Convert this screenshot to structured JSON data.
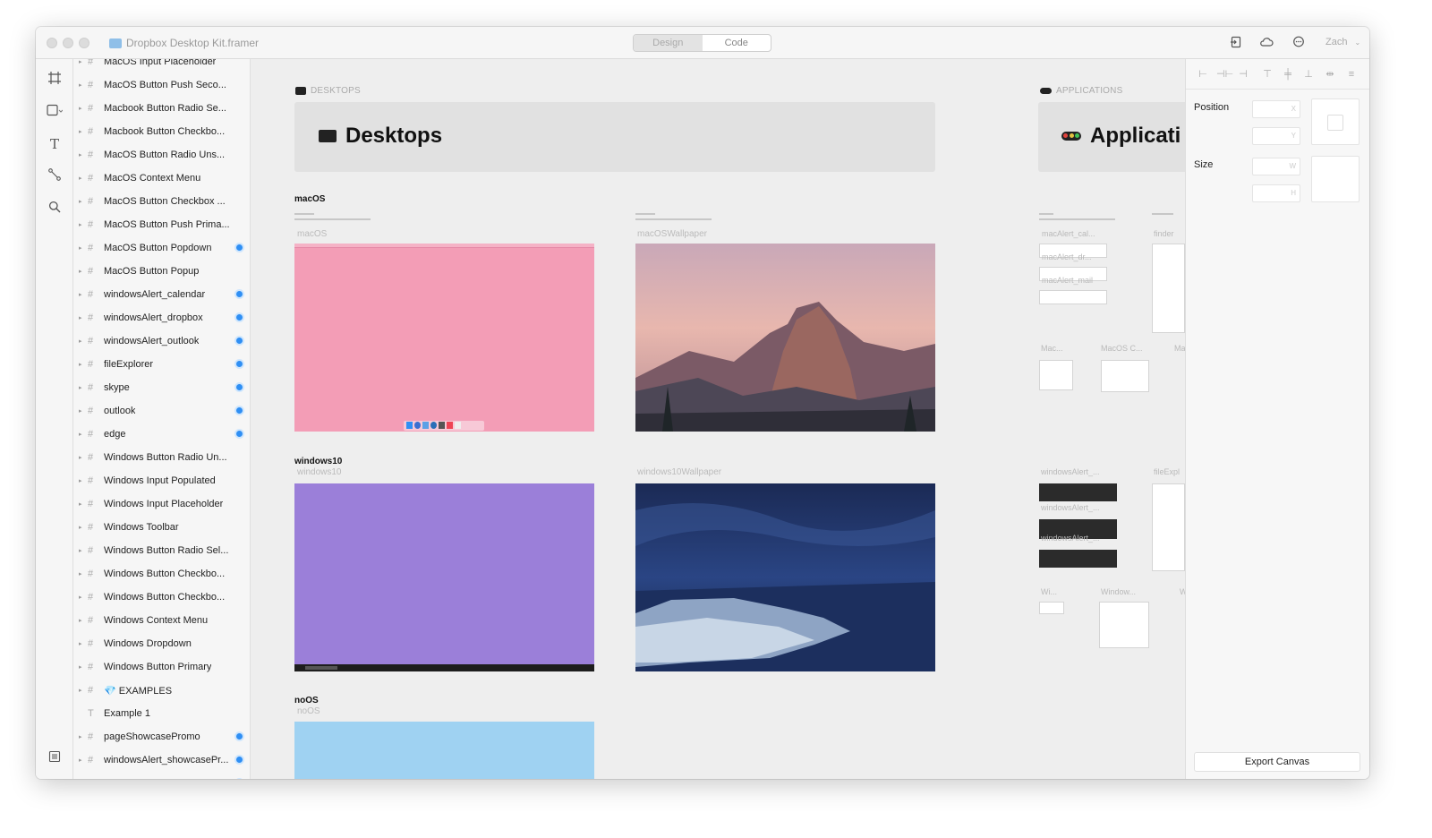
{
  "window": {
    "title": "Dropbox Desktop Kit.framer",
    "mode_tabs": [
      "Design",
      "Code"
    ],
    "active_mode": "Design",
    "user": "Zach",
    "toolbar_icons": [
      "preview-icon",
      "cloud-icon",
      "comment-icon"
    ]
  },
  "tools": [
    "frame-tool-icon",
    "shape-tool-icon",
    "text-tool-icon",
    "path-tool-icon",
    "search-tool-icon"
  ],
  "layers": [
    {
      "name": "MacOS Input Placeholder",
      "expand": true,
      "icon": "#",
      "tick": false
    },
    {
      "name": "MacOS Button Push Seco...",
      "expand": true,
      "icon": "#",
      "tick": false
    },
    {
      "name": "Macbook Button Radio Se...",
      "expand": true,
      "icon": "#",
      "tick": false
    },
    {
      "name": "Macbook Button Checkbo...",
      "expand": true,
      "icon": "#",
      "tick": false
    },
    {
      "name": "MacOS Button Radio Uns...",
      "expand": true,
      "icon": "#",
      "tick": false
    },
    {
      "name": "MacOS Context Menu",
      "expand": true,
      "icon": "#",
      "tick": false
    },
    {
      "name": "MacOS Button Checkbox ...",
      "expand": true,
      "icon": "#",
      "tick": false
    },
    {
      "name": "MacOS Button Push Prima...",
      "expand": true,
      "icon": "#",
      "tick": false
    },
    {
      "name": "MacOS Button Popdown",
      "expand": true,
      "icon": "#",
      "tick": true
    },
    {
      "name": "MacOS Button Popup",
      "expand": true,
      "icon": "#",
      "tick": false
    },
    {
      "name": "windowsAlert_calendar",
      "expand": true,
      "icon": "#",
      "tick": true
    },
    {
      "name": "windowsAlert_dropbox",
      "expand": true,
      "icon": "#",
      "tick": true
    },
    {
      "name": "windowsAlert_outlook",
      "expand": true,
      "icon": "#",
      "tick": true
    },
    {
      "name": "fileExplorer",
      "expand": true,
      "icon": "#",
      "tick": true
    },
    {
      "name": "skype",
      "expand": true,
      "icon": "#",
      "tick": true
    },
    {
      "name": "outlook",
      "expand": true,
      "icon": "#",
      "tick": true
    },
    {
      "name": "edge",
      "expand": true,
      "icon": "#",
      "tick": true
    },
    {
      "name": "Windows Button Radio Un...",
      "expand": true,
      "icon": "#",
      "tick": false
    },
    {
      "name": "Windows Input Populated",
      "expand": true,
      "icon": "#",
      "tick": false
    },
    {
      "name": "Windows Input Placeholder",
      "expand": true,
      "icon": "#",
      "tick": false
    },
    {
      "name": "Windows Toolbar",
      "expand": true,
      "icon": "#",
      "tick": false
    },
    {
      "name": "Windows Button Radio Sel...",
      "expand": true,
      "icon": "#",
      "tick": false
    },
    {
      "name": "Windows Button Checkbo...",
      "expand": true,
      "icon": "#",
      "tick": false
    },
    {
      "name": "Windows Button Checkbo...",
      "expand": true,
      "icon": "#",
      "tick": false
    },
    {
      "name": "Windows Context Menu",
      "expand": true,
      "icon": "#",
      "tick": false
    },
    {
      "name": "Windows Dropdown",
      "expand": true,
      "icon": "#",
      "tick": false
    },
    {
      "name": "Windows Button Primary",
      "expand": true,
      "icon": "#",
      "tick": false
    },
    {
      "name": "💎 EXAMPLES",
      "expand": true,
      "icon": "#",
      "tick": false
    },
    {
      "name": "Example 1",
      "expand": false,
      "icon": "T",
      "tick": false
    },
    {
      "name": "pageShowcasePromo",
      "expand": true,
      "icon": "#",
      "tick": true
    },
    {
      "name": "windowsAlert_showcasePr...",
      "expand": true,
      "icon": "#",
      "tick": true
    },
    {
      "name": "",
      "expand": true,
      "icon": "#",
      "tick": true
    }
  ],
  "canvas": {
    "desktops": {
      "label": "DESKTOPS",
      "title": "Desktops",
      "frames": [
        {
          "title": "macOS",
          "name": "macOS",
          "color": "#f39db6"
        },
        {
          "title": "",
          "name": "macOSWallpaper",
          "color": "wallpaper-mountain"
        },
        {
          "title": "windows10",
          "name": "windows10",
          "color": "#9b7fd9"
        },
        {
          "title": "",
          "name": "windows10Wallpaper",
          "color": "wallpaper-ocean"
        },
        {
          "title": "noOS",
          "name": "noOS",
          "color": "#9fd2f2"
        }
      ]
    },
    "applications": {
      "label": "APPLICATIONS",
      "title": "Applicati",
      "faint": [
        "macAlert_cal...",
        "macAlert_dr...",
        "macAlert_mail",
        "finder",
        "Mac...",
        "MacOS C...",
        "Ma",
        "windowsAlert_...",
        "windowsAlert_...",
        "windowsAlert_...",
        "fileExpl",
        "Wi...",
        "Window...",
        "W"
      ]
    }
  },
  "inspector": {
    "position_label": "Position",
    "size_label": "Size",
    "field_x": "X",
    "field_y": "Y",
    "field_w": "W",
    "field_h": "H",
    "export_label": "Export Canvas"
  },
  "colors": {
    "accent": "#2f8ff4",
    "macos_pink": "#f39db6",
    "windows_purple": "#9b7fd9",
    "noos_blue": "#9fd2f2"
  }
}
